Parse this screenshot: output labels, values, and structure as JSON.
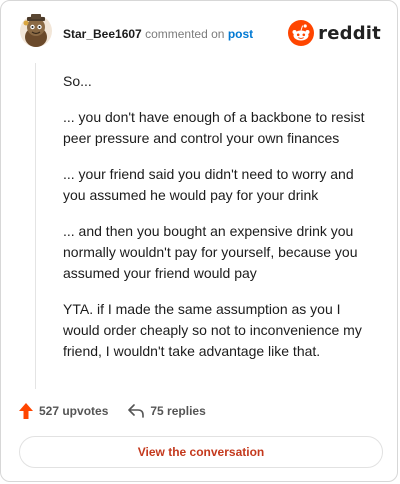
{
  "header": {
    "username": "Star_Bee1607",
    "action_text": "commented on",
    "post_link": "post",
    "brand": "reddit"
  },
  "comment": {
    "paragraphs": [
      "So...",
      "... you don't have enough of a backbone to resist peer pressure and control your own finances",
      "... your friend said you didn't need to worry and you assumed he would pay for your drink",
      "... and then you bought an expensive drink you normally wouldn't pay for yourself, because you assumed your friend would pay",
      "YTA. if I made the same assumption as you I would order cheaply so not to inconvenience my friend, I wouldn't take advantage like that."
    ]
  },
  "stats": {
    "upvotes": "527 upvotes",
    "replies": "75 replies"
  },
  "cta": {
    "label": "View the conversation"
  },
  "colors": {
    "brand_orange": "#ff4500",
    "link_blue": "#0079d3",
    "cta_text": "#c4391d"
  }
}
